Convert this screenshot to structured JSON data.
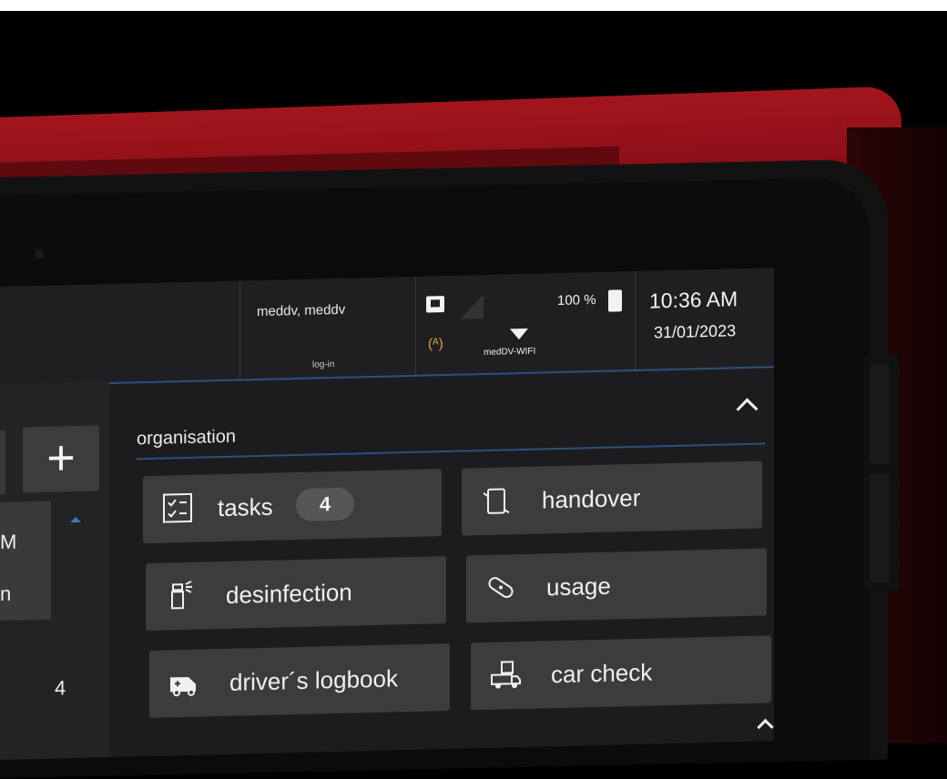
{
  "status_bar": {
    "user": "meddv, meddv",
    "login": "log-in",
    "battery": "100 %",
    "wifi_name": "medDV-WIFI",
    "time": "10:36 AM",
    "date": "31/01/2023"
  },
  "left_panel": {
    "list_lines": [
      "M",
      "n"
    ],
    "page_number": "4"
  },
  "section": {
    "title": "organisation"
  },
  "tiles": [
    {
      "label": "tasks",
      "badge": "4",
      "icon": "checklist-icon"
    },
    {
      "label": "handover",
      "icon": "handover-icon"
    },
    {
      "label": "desinfection",
      "icon": "spray-bottle-icon"
    },
    {
      "label": "usage",
      "icon": "bandage-icon"
    },
    {
      "label": "driver´s logbook",
      "icon": "ambulance-icon"
    },
    {
      "label": "car check",
      "icon": "truck-check-icon"
    }
  ],
  "colors": {
    "case_red": "#9a1219",
    "screen_bg": "#1c1c1e",
    "tile_bg": "#3c3c3e",
    "accent_line": "#2d4f7a",
    "antenna": "#d9a73b"
  }
}
